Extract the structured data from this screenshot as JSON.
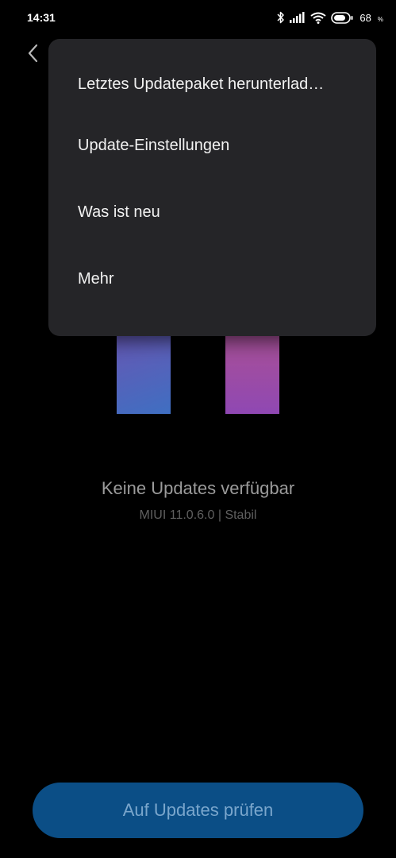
{
  "status_bar": {
    "time": "14:31",
    "battery_level": "68",
    "battery_unit": "%",
    "icons": [
      "bluetooth-icon",
      "signal-icon",
      "wifi-icon",
      "battery-icon"
    ]
  },
  "header": {
    "back_icon": "back-chevron-icon"
  },
  "menu": {
    "items": [
      {
        "label": "Letztes Updatepaket herunterlad…"
      },
      {
        "label": "Update-Einstellungen"
      },
      {
        "label": "Was ist neu"
      },
      {
        "label": "Mehr"
      }
    ]
  },
  "main": {
    "status": "Keine Updates verfügbar",
    "version": "MIUI 11.0.6.0 | Stabil"
  },
  "footer": {
    "check_button_label": "Auf Updates prüfen"
  },
  "colors": {
    "background": "#000000",
    "menu_background": "#252528",
    "button_background": "#0b4e86",
    "button_text": "#7aa6cc"
  }
}
